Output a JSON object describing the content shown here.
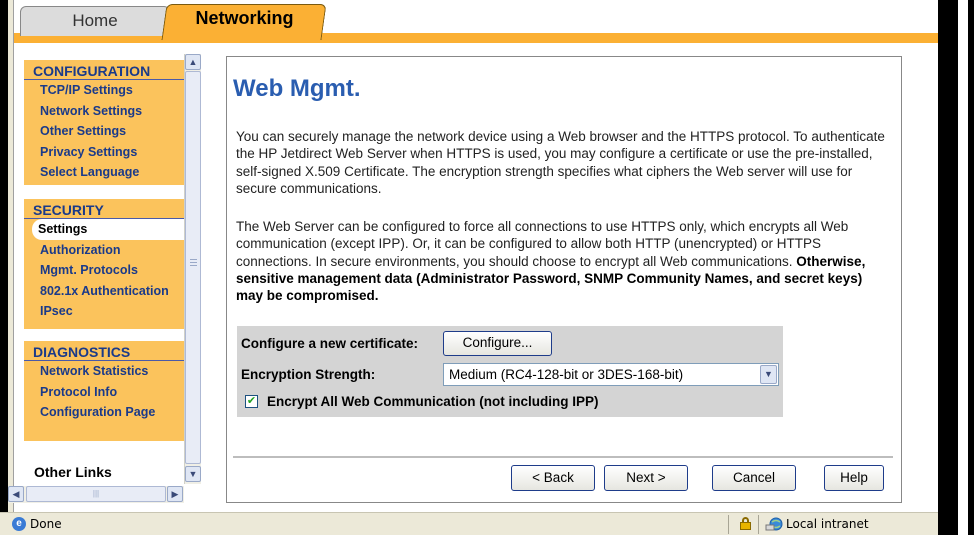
{
  "tabs": {
    "home": "Home",
    "networking": "Networking"
  },
  "sidebar": {
    "sections": [
      {
        "heading": "CONFIGURATION",
        "items": [
          "TCP/IP Settings",
          "Network Settings",
          "Other Settings",
          "Privacy Settings",
          "Select Language"
        ]
      },
      {
        "heading": "SECURITY",
        "items": [
          "Settings",
          "Authorization",
          "Mgmt. Protocols",
          "802.1x Authentication",
          "IPsec"
        ],
        "active": "Settings"
      },
      {
        "heading": "DIAGNOSTICS",
        "items": [
          "Network Statistics",
          "Protocol Info",
          "Configuration Page"
        ]
      }
    ],
    "other_links": "Other Links"
  },
  "main": {
    "title": "Web Mgmt.",
    "paragraph1": "You can securely manage the network device using a Web browser and the HTTPS protocol. To authenticate the HP Jetdirect Web Server when HTTPS is used, you may configure a certificate or use the pre-installed, self-signed X.509 Certificate. The encryption strength specifies what ciphers the Web server will use for secure communications.",
    "paragraph2_normal": "The Web Server can be configured to force all connections to use HTTPS only, which encrypts all Web communication (except IPP). Or, it can be configured to allow both HTTP (unencrypted) or HTTPS connections. In secure environments, you should choose to encrypt all Web communications. ",
    "paragraph2_bold": "Otherwise, sensitive management data (Administrator Password, SNMP Community Names, and secret keys) may be compromised.",
    "config": {
      "certificate_label": "Configure a new certificate:",
      "configure_button": "Configure...",
      "encryption_label": "Encryption Strength:",
      "encryption_value": "Medium (RC4-128-bit or 3DES-168-bit)",
      "encrypt_all_label": "Encrypt All Web Communication (not including IPP)",
      "encrypt_all_checked": true,
      "checkmark": "✔"
    },
    "buttons": {
      "back": "< Back",
      "next": "Next >",
      "cancel": "Cancel",
      "help": "Help"
    }
  },
  "statusbar": {
    "text": "Done",
    "zone": "Local intranet"
  },
  "colors": {
    "tab_accent": "#fbb034",
    "sidebar_bg": "#fbc35c",
    "title_blue": "#2a5db0",
    "link_blue": "#1a3a8a"
  }
}
